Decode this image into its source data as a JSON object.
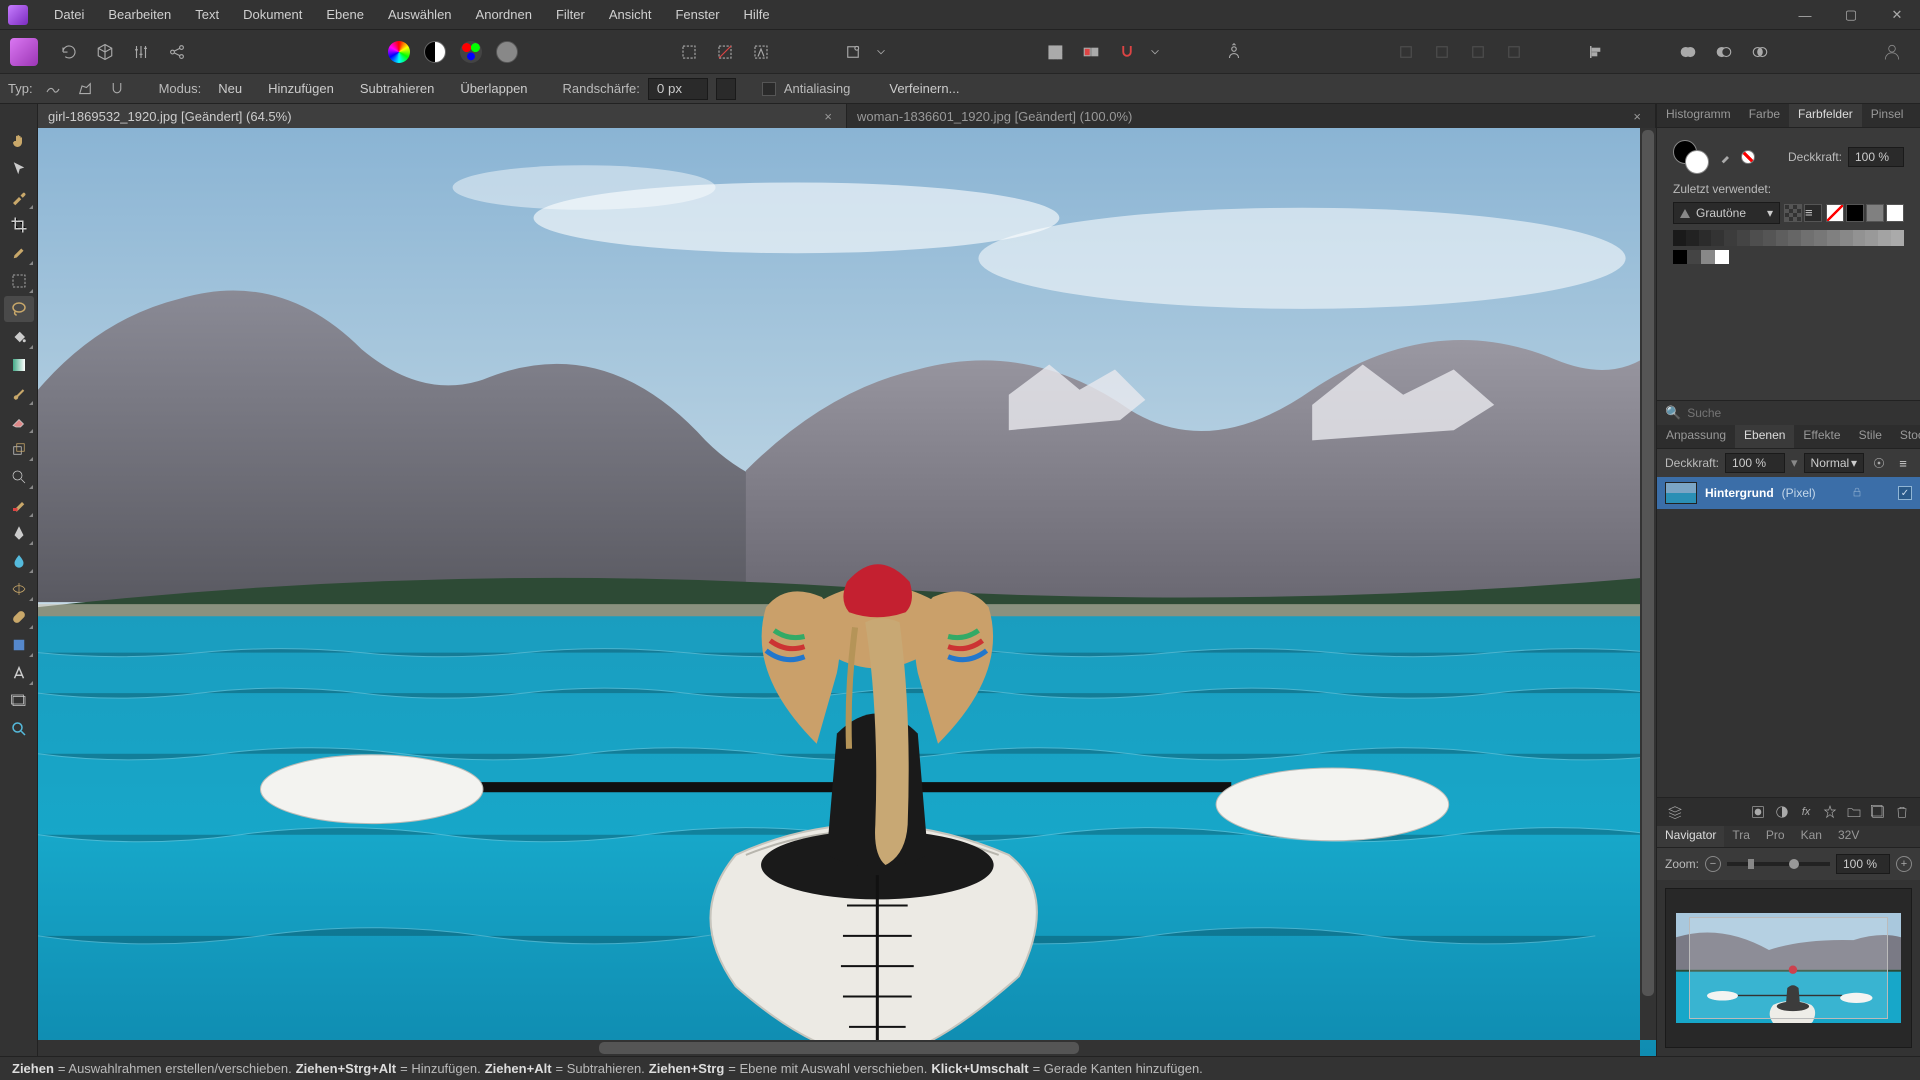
{
  "menu": {
    "items": [
      "Datei",
      "Bearbeiten",
      "Text",
      "Dokument",
      "Ebene",
      "Auswählen",
      "Anordnen",
      "Filter",
      "Ansicht",
      "Fenster",
      "Hilfe"
    ]
  },
  "context": {
    "type_label": "Typ:",
    "mode_label": "Modus:",
    "mode_new": "Neu",
    "mode_add": "Hinzufügen",
    "mode_sub": "Subtrahieren",
    "mode_int": "Überlappen",
    "feather_label": "Randschärfe:",
    "feather_value": "0 px",
    "antialias": "Antialiasing",
    "refine": "Verfeinern..."
  },
  "tabs": [
    {
      "title": "girl-1869532_1920.jpg [Geändert] (64.5%)",
      "active": true
    },
    {
      "title": "woman-1836601_1920.jpg [Geändert] (100.0%)",
      "active": false
    }
  ],
  "swatches": {
    "tabs": [
      "Histogramm",
      "Farbe",
      "Farbfelder",
      "Pinsel"
    ],
    "active_tab": 2,
    "opacity_label": "Deckkraft:",
    "opacity_value": "100 %",
    "recent_label": "Zuletzt verwendet:",
    "palette_name": "Grautöne",
    "search_placeholder": "Suche",
    "greys": [
      "#1a1a1a",
      "#222",
      "#2b2b2b",
      "#333",
      "#3c3c3c",
      "#444",
      "#4e4e4e",
      "#555",
      "#5e5e5e",
      "#666",
      "#707070",
      "#777",
      "#808080",
      "#888",
      "#929292",
      "#999",
      "#a3a3a3",
      "#aaa"
    ],
    "row2": [
      "#000",
      "#444",
      "#888",
      "#fff"
    ]
  },
  "layers": {
    "tabs": [
      "Anpassung",
      "Ebenen",
      "Effekte",
      "Stile",
      "Stock"
    ],
    "active_tab": 1,
    "opacity_label": "Deckkraft:",
    "opacity_value": "100 %",
    "blend_mode": "Normal",
    "items": [
      {
        "name": "Hintergrund",
        "type": "(Pixel)"
      }
    ]
  },
  "navigator": {
    "tabs": [
      "Navigator",
      "Tra",
      "Pro",
      "Kan",
      "32V"
    ],
    "active_tab": 0,
    "zoom_label": "Zoom:",
    "zoom_value": "100 %"
  },
  "status": {
    "s1k": "Ziehen",
    "s1t": " = Auswahlrahmen erstellen/verschieben. ",
    "s2k": "Ziehen+Strg+Alt",
    "s2t": " = Hinzufügen. ",
    "s3k": "Ziehen+Alt",
    "s3t": " = Subtrahieren. ",
    "s4k": "Ziehen+Strg",
    "s4t": " = Ebene mit Auswahl verschieben. ",
    "s5k": "Klick+Umschalt",
    "s5t": " = Gerade Kanten hinzufügen."
  }
}
